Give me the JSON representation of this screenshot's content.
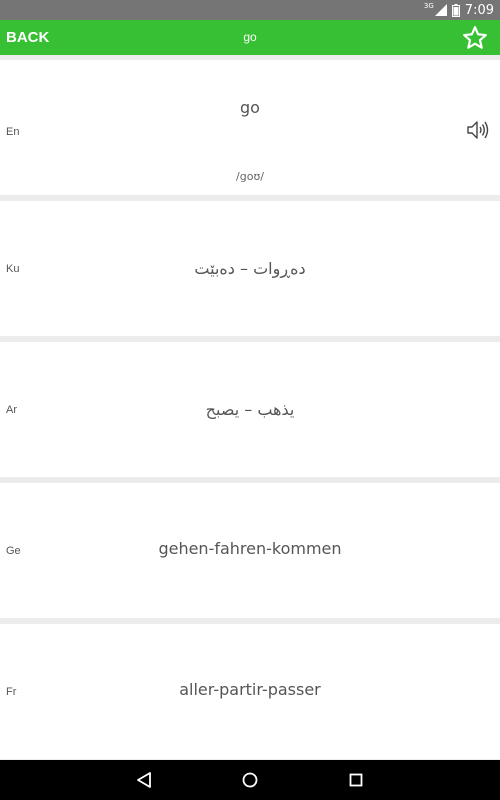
{
  "status_bar": {
    "network_label": "3G",
    "time": "7:09",
    "icons": [
      "signal-icon",
      "battery-icon"
    ]
  },
  "app_bar": {
    "back_label": "BACK",
    "title": "go",
    "favorite_icon": "star-outline-icon"
  },
  "entries": [
    {
      "lang": "En",
      "text": "go",
      "phonetic": "/goʊ/",
      "has_audio": true
    },
    {
      "lang": "Ku",
      "text": "دەڕوات – دەبێت"
    },
    {
      "lang": "Ar",
      "text": "يذهب – يصبح"
    },
    {
      "lang": "Ge",
      "text": "gehen-fahren-kommen"
    },
    {
      "lang": "Fr",
      "text": "aller-partir-passer"
    }
  ],
  "nav_bar": {
    "icons": [
      "back-triangle-icon",
      "home-circle-icon",
      "recents-square-icon"
    ]
  },
  "colors": {
    "app_bar": "#37c033",
    "status_bar": "#757575",
    "background": "#ececec",
    "card": "#ffffff",
    "text": "#555555"
  }
}
